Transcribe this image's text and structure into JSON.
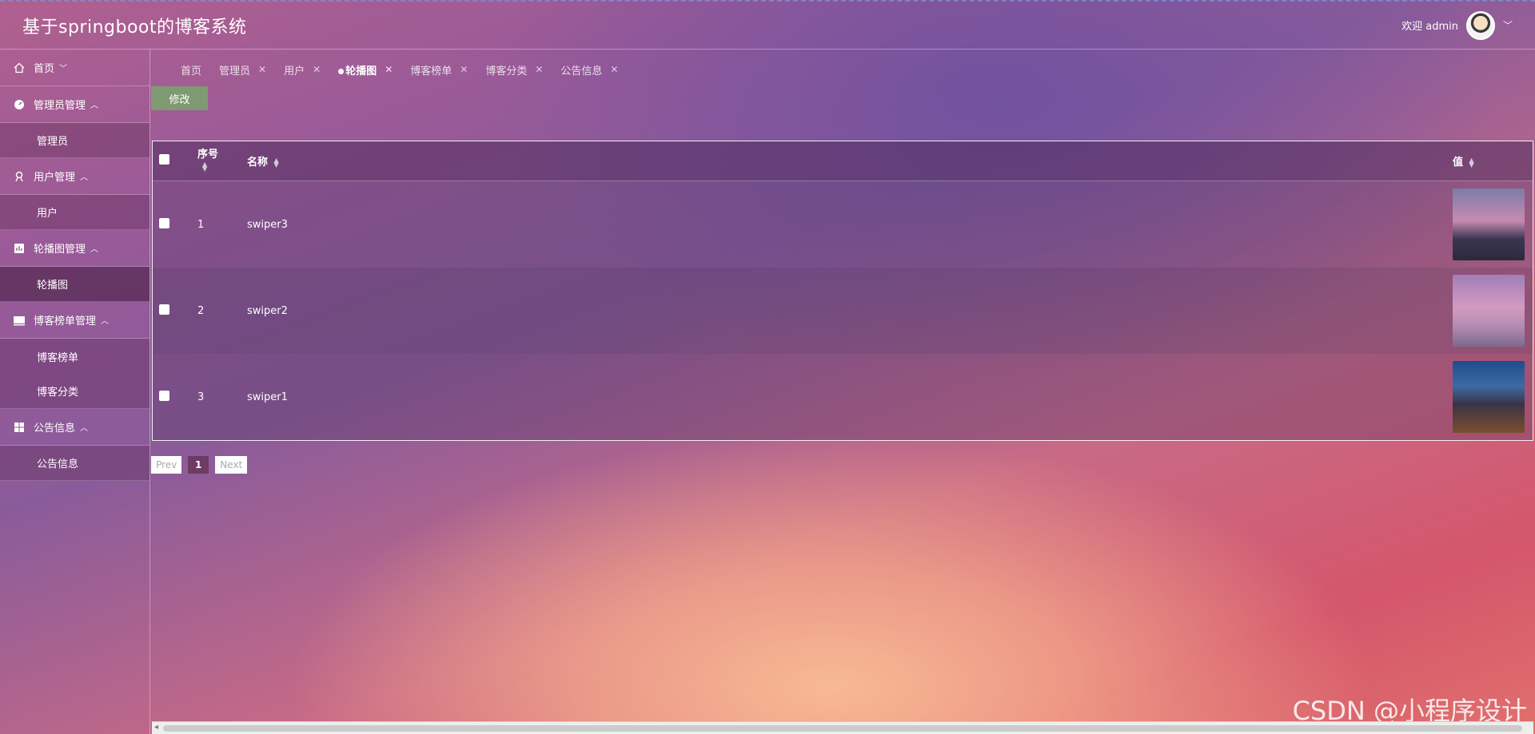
{
  "header": {
    "title": "基于springboot的博客系统",
    "welcome": "欢迎 admin"
  },
  "sidebar": {
    "home": "首页",
    "groups": [
      {
        "title": "管理员管理",
        "items": [
          "管理员"
        ]
      },
      {
        "title": "用户管理",
        "items": [
          "用户"
        ]
      },
      {
        "title": "轮播图管理",
        "items": [
          "轮播图"
        ]
      },
      {
        "title": "博客榜单管理",
        "items": [
          "博客榜单",
          "博客分类"
        ]
      },
      {
        "title": "公告信息",
        "items": [
          "公告信息"
        ]
      }
    ]
  },
  "tabs": [
    {
      "label": "首页",
      "closable": false
    },
    {
      "label": "管理员",
      "closable": true
    },
    {
      "label": "用户",
      "closable": true
    },
    {
      "label": "轮播图",
      "closable": true,
      "active": true
    },
    {
      "label": "博客榜单",
      "closable": true
    },
    {
      "label": "博客分类",
      "closable": true
    },
    {
      "label": "公告信息",
      "closable": true
    }
  ],
  "toolbar": {
    "edit_label": "修改"
  },
  "table": {
    "columns": {
      "seq": "序号",
      "name": "名称",
      "value": "值"
    },
    "rows": [
      {
        "seq": "1",
        "name": "swiper3"
      },
      {
        "seq": "2",
        "name": "swiper2"
      },
      {
        "seq": "3",
        "name": "swiper1"
      }
    ]
  },
  "pager": {
    "prev": "Prev",
    "current": "1",
    "next": "Next"
  },
  "watermark": "CSDN @小程序设计",
  "colors": {
    "edit_button": "#7f9a72",
    "pager_active": "#6d3b63"
  }
}
